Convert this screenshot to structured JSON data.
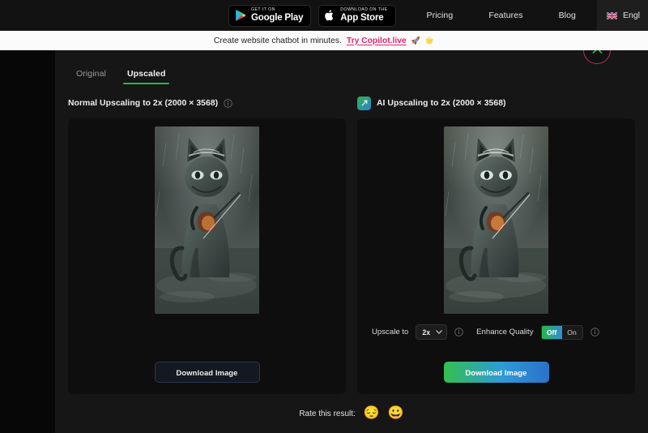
{
  "topnav": {
    "google_play": {
      "small": "GET IT ON",
      "big": "Google Play",
      "icon": "google-play-icon"
    },
    "app_store": {
      "small": "Download on the",
      "big": "App Store",
      "icon": "apple-icon"
    },
    "links": [
      {
        "label": "Pricing"
      },
      {
        "label": "Features"
      },
      {
        "label": "Blog"
      }
    ],
    "language": {
      "label": "Engl",
      "flag": "uk-flag-icon"
    }
  },
  "promo": {
    "text": "Create website chatbot in minutes.",
    "link": "Try Copilot.live",
    "emoji_1": "🚀",
    "emoji_2": "🌟"
  },
  "scroll_top": {
    "icon": "chevron-up-icon",
    "border_color": "#b9315c",
    "icon_color": "#2eb34a"
  },
  "tabs": [
    {
      "label": "Original",
      "active": false
    },
    {
      "label": "Upscaled",
      "active": true
    }
  ],
  "left_panel": {
    "title": "Normal Upscaling to 2x (2000 × 3568)",
    "info_icon": "info-circle-icon",
    "download_label": "Download Image"
  },
  "right_panel": {
    "title": "AI Upscaling to 2x (2000 × 3568)",
    "badge_icon": "ai-expand-icon",
    "info_icon": "info-circle-icon",
    "upscale_label": "Upscale to",
    "upscale_value": "2x",
    "upscale_info_icon": "info-circle-icon",
    "enhance_label": "Enhance Quality",
    "enhance_off": "Off",
    "enhance_on": "On",
    "enhance_selected": "Off",
    "enhance_info_icon": "info-circle-icon",
    "download_label": "Download Image"
  },
  "rate": {
    "label": "Rate this result:",
    "sad_emoji": "😔",
    "happy_emoji": "😀"
  },
  "colors": {
    "accent_green": "#2eb34a",
    "accent_blue": "#2f80d8",
    "promo_pink": "#e8256f",
    "page_bg": "#0a0a0a",
    "main_bg": "#161616",
    "card_bg": "#0e0e0e"
  }
}
